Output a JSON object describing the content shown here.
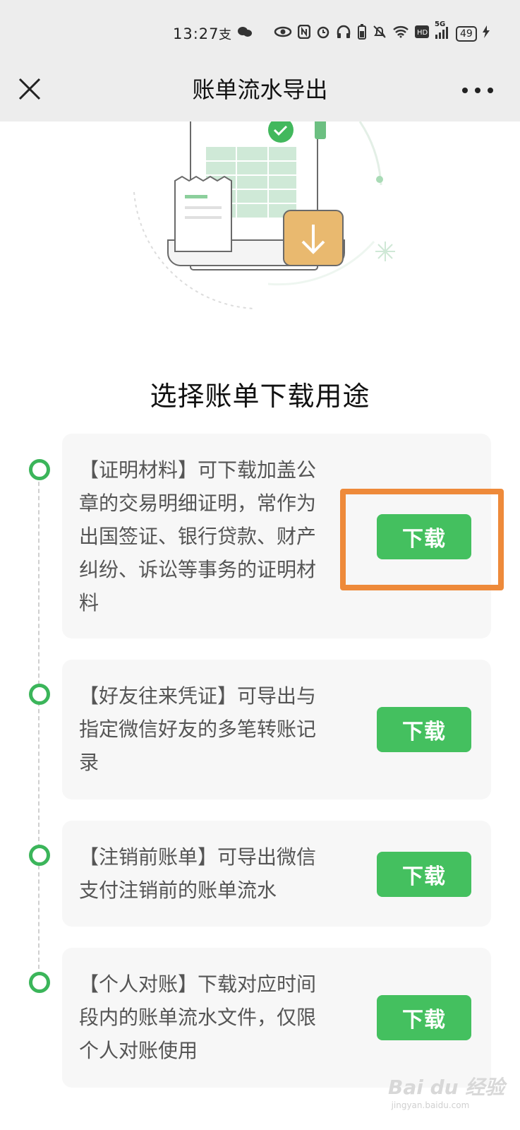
{
  "status_bar": {
    "time": "13:27",
    "signal_label": "5G",
    "battery": "49",
    "icons": [
      "alipay-icon",
      "wechat-icon",
      "eye-icon",
      "nfc-icon",
      "alarm-icon",
      "headphones-icon",
      "battery-small-icon",
      "mute-icon",
      "wifi-icon",
      "hd-icon",
      "signal-icon",
      "charging-icon"
    ]
  },
  "nav": {
    "title": "账单流水导出",
    "close_icon": "close-icon",
    "more_icon": "more-icon"
  },
  "section_title": "选择账单下载用途",
  "cards": [
    {
      "text": "【证明材料】可下载加盖公章的交易明细证明，常作为出国签证、银行贷款、财产纠纷、诉讼等事务的证明材料",
      "button": "下载"
    },
    {
      "text": "【好友往来凭证】可导出与指定微信好友的多笔转账记录",
      "button": "下载"
    },
    {
      "text": "【注销前账单】可导出微信支付注销前的账单流水",
      "button": "下载"
    },
    {
      "text": "【个人对账】下载对应时间段内的账单流水文件，仅限个人对账使用",
      "button": "下载"
    }
  ],
  "colors": {
    "accent_green": "#44c05f",
    "timeline_green": "#3bb55a",
    "highlight_orange": "#ee8a3a",
    "card_bg": "#f7f7f7",
    "topbar_bg": "#ededed"
  },
  "watermark": {
    "brand": "Bai du 经验",
    "url": "jingyan.baidu.com"
  }
}
